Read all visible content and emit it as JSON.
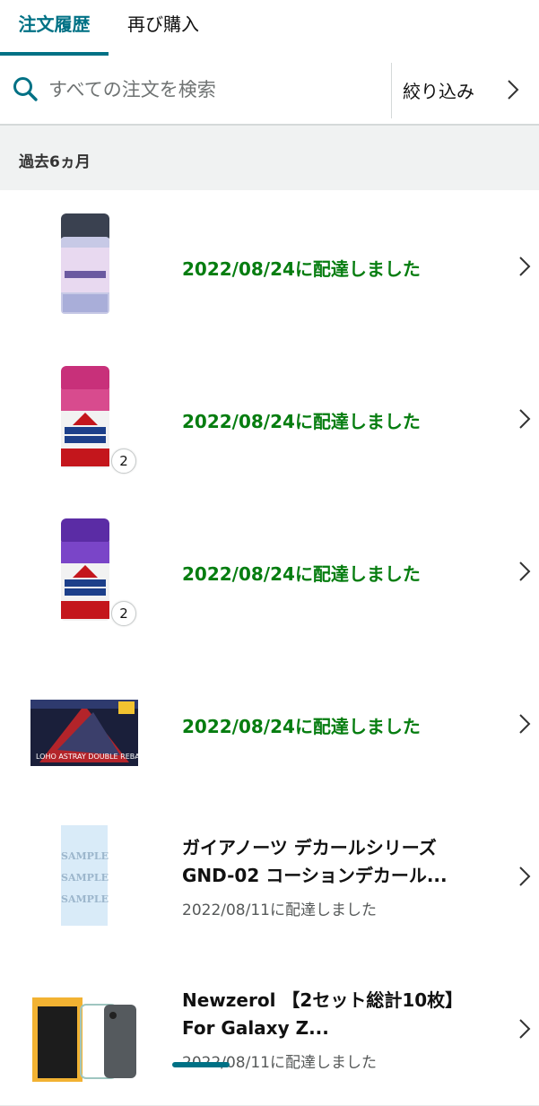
{
  "tabs": [
    {
      "label": "注文履歴",
      "active": true
    },
    {
      "label": "再び購入",
      "active": false
    }
  ],
  "search": {
    "placeholder": "すべての注文を検索",
    "value": ""
  },
  "filter": {
    "label": "絞り込み"
  },
  "period": {
    "label": "過去6ヵ月"
  },
  "orders": [
    {
      "status": "2022/08/24に配達しました",
      "thumb": "gundam-color-spray-can"
    },
    {
      "status": "2022/08/24に配達しました",
      "thumb": "tamiya-color-spray-pink",
      "quantity": "2"
    },
    {
      "status": "2022/08/24に配達しました",
      "thumb": "tamiya-color-spray-purple",
      "quantity": "2"
    },
    {
      "status": "2022/08/24に配達しました",
      "thumb": "gunpla-model-kit-box",
      "box_text": "LOHO ASTRAY DOUBLE REBAKE"
    },
    {
      "title": "ガイアノーツ デカールシリーズ GND-02 コーションデカール...",
      "subtitle": "2022/08/11に配達しました",
      "thumb": "caution-decal-sheet",
      "sample_text": "SAMPLE"
    },
    {
      "title": "Newzerol 【2セット総計10枚】For Galaxy Z...",
      "subtitle": "2022/08/11に配達しました",
      "thumb": "galaxy-z-flip-protector-pack"
    }
  ],
  "colors": {
    "accent": "#007185",
    "delivered_green": "#067d10",
    "divider": "#e7e9e9",
    "section_bg": "#f0f2f2"
  }
}
